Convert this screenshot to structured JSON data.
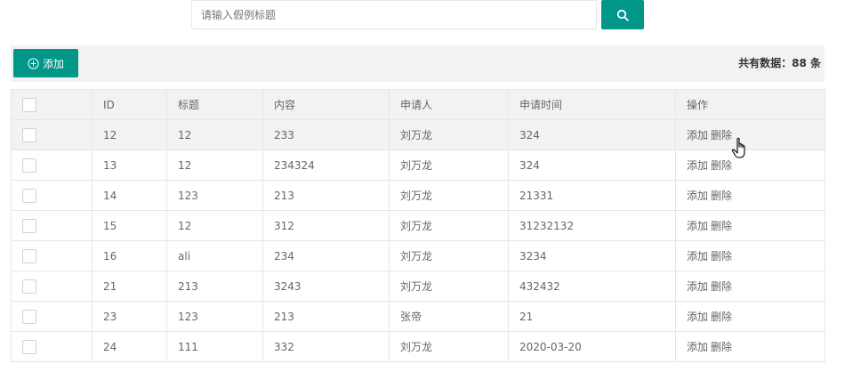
{
  "search": {
    "placeholder": "请输入假例标题",
    "button_icon": "search-icon"
  },
  "toolbar": {
    "add_label": "添加",
    "add_icon": "plus-circle-icon",
    "total_text": "共有数据：88 条"
  },
  "table": {
    "headers": [
      "ID",
      "标题",
      "内容",
      "申请人",
      "申请时间",
      "操作"
    ],
    "action_add": "添加",
    "action_delete": "删除",
    "rows": [
      {
        "id": "12",
        "title": "12",
        "content": "233",
        "applicant": "刘万龙",
        "time": "324"
      },
      {
        "id": "13",
        "title": "12",
        "content": "234324",
        "applicant": "刘万龙",
        "time": "324"
      },
      {
        "id": "14",
        "title": "123",
        "content": "213",
        "applicant": "刘万龙",
        "time": "21331"
      },
      {
        "id": "15",
        "title": "12",
        "content": "312",
        "applicant": "刘万龙",
        "time": "31232132"
      },
      {
        "id": "16",
        "title": "ali",
        "content": "234",
        "applicant": "刘万龙",
        "time": "3234"
      },
      {
        "id": "21",
        "title": "213",
        "content": "3243",
        "applicant": "刘万龙",
        "time": "432432"
      },
      {
        "id": "23",
        "title": "123",
        "content": "213",
        "applicant": "张帝",
        "time": "21"
      },
      {
        "id": "24",
        "title": "111",
        "content": "332",
        "applicant": "刘万龙",
        "time": "2020-03-20"
      }
    ]
  },
  "colors": {
    "accent": "#009688",
    "header_bg": "#f2f2f2",
    "border": "#e6e6e6"
  }
}
